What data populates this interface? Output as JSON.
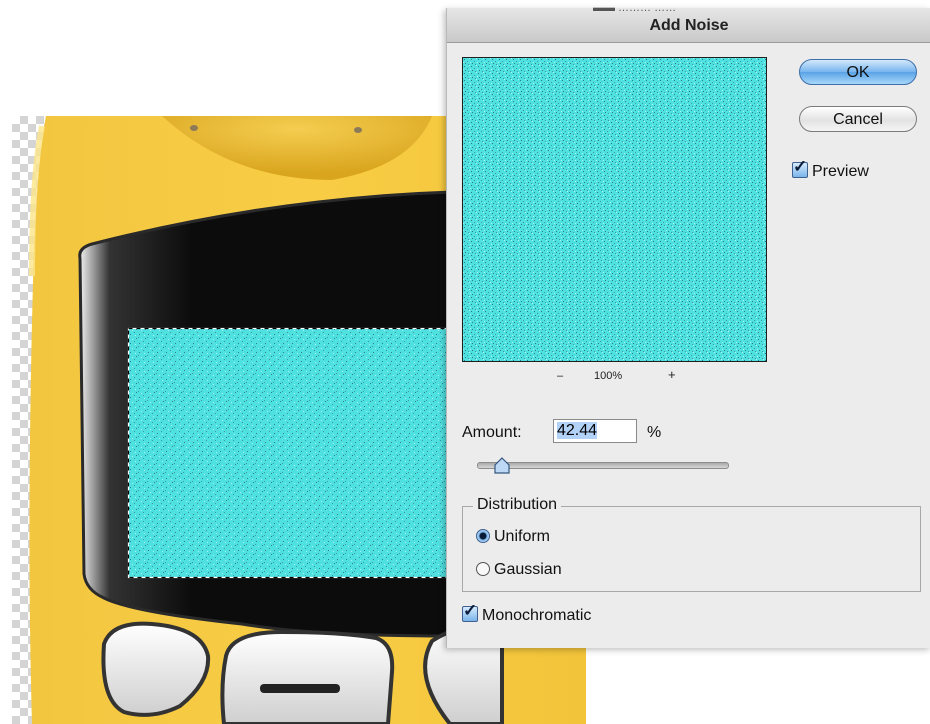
{
  "dialog": {
    "title": "Add Noise",
    "title_fragment": "▬▬ ……… ……",
    "zoom": {
      "out_label": "–",
      "percent": "100%",
      "in_label": "+"
    },
    "ok_label": "OK",
    "cancel_label": "Cancel",
    "preview_label": "Preview",
    "preview_checked": true,
    "amount_label": "Amount:",
    "amount_value": "42.44",
    "amount_unit": "%",
    "amount_slider_fraction": 0.1,
    "distribution": {
      "legend": "Distribution",
      "options": [
        {
          "label": "Uniform",
          "selected": true
        },
        {
          "label": "Gaussian",
          "selected": false
        }
      ]
    },
    "monochromatic_label": "Monochromatic",
    "monochromatic_checked": true
  },
  "colors": {
    "noise_fill": "#4fe0e0",
    "phone_body": "#f7c83f",
    "screen": "#111111",
    "ok_accent": "#5aa3e6"
  },
  "icons": [
    "checkmark-icon",
    "slider-thumb-icon",
    "radio-icon"
  ]
}
